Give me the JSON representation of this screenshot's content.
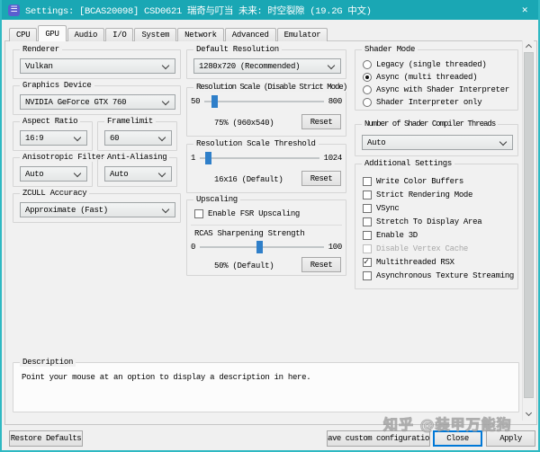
{
  "window": {
    "title": "Settings: [BCAS20098] CSD0621 瑞奇与叮当 未来: 时空裂隙 (19.2G 中文)",
    "icon_glyph": "☰",
    "close_glyph": "✕"
  },
  "tabs": {
    "items": [
      "CPU",
      "GPU",
      "Audio",
      "I/O",
      "System",
      "Network",
      "Advanced",
      "Emulator"
    ],
    "active": "GPU"
  },
  "gpu": {
    "renderer": {
      "label": "Renderer",
      "value": "Vulkan"
    },
    "graphics_device": {
      "label": "Graphics Device",
      "value": "NVIDIA GeForce GTX 760"
    },
    "aspect_ratio": {
      "label": "Aspect Ratio",
      "value": "16:9"
    },
    "framelimit": {
      "label": "Framelimit",
      "value": "60"
    },
    "anisotropic_filter": {
      "label": "Anisotropic Filter",
      "value": "Auto"
    },
    "anti_aliasing": {
      "label": "Anti-Aliasing",
      "value": "Auto"
    },
    "zcull_accuracy": {
      "label": "ZCULL Accuracy",
      "value": "Approximate (Fast)"
    },
    "default_resolution": {
      "label": "Default Resolution",
      "value": "1280x720 (Recommended)"
    },
    "resolution_scale": {
      "label": "Resolution Scale (Disable Strict Mode)",
      "min": "50",
      "max": "800",
      "value_label": "75% (960x540)",
      "reset": "Reset"
    },
    "resolution_scale_threshold": {
      "label": "Resolution Scale Threshold",
      "min": "1",
      "max": "1024",
      "value_label": "16x16 (Default)",
      "reset": "Reset"
    },
    "upscaling": {
      "label": "Upscaling",
      "fsr_label": "Enable FSR Upscaling",
      "fsr_checked": false,
      "rcas_label": "RCAS Sharpening Strength",
      "min": "0",
      "max": "100",
      "value_label": "50% (Default)",
      "reset": "Reset"
    },
    "shader_mode": {
      "label": "Shader Mode",
      "options": [
        {
          "label": "Legacy (single threaded)",
          "selected": false
        },
        {
          "label": "Async (multi threaded)",
          "selected": true
        },
        {
          "label": "Async with Shader Interpreter",
          "selected": false
        },
        {
          "label": "Shader Interpreter only",
          "selected": false
        }
      ]
    },
    "shader_compiler_threads": {
      "label": "Number of Shader Compiler Threads",
      "value": "Auto"
    },
    "additional_settings": {
      "label": "Additional Settings",
      "options": [
        {
          "label": "Write Color Buffers",
          "checked": false,
          "disabled": false
        },
        {
          "label": "Strict Rendering Mode",
          "checked": false,
          "disabled": false
        },
        {
          "label": "VSync",
          "checked": false,
          "disabled": false
        },
        {
          "label": "Stretch To Display Area",
          "checked": false,
          "disabled": false
        },
        {
          "label": "Enable 3D",
          "checked": false,
          "disabled": false
        },
        {
          "label": "Disable Vertex Cache",
          "checked": false,
          "disabled": true
        },
        {
          "label": "Multithreaded RSX",
          "checked": true,
          "disabled": false
        },
        {
          "label": "Asynchronous Texture Streaming",
          "checked": false,
          "disabled": false
        }
      ]
    }
  },
  "description": {
    "label": "Description",
    "text": "Point your mouse at an option to display a description in here."
  },
  "footer": {
    "restore_defaults": "Restore Defaults",
    "save_custom_configuration": "Save custom configuration",
    "close": "Close",
    "apply": "Apply"
  },
  "watermark": "知乎 @装甲万能狗",
  "colors": {
    "titlebar": "#1aa7b4",
    "window_border": "#2fb9c3",
    "slider_handle": "#2f7fc9",
    "focus_border": "#0078d7",
    "dialog_bg": "#f0f0f0"
  }
}
